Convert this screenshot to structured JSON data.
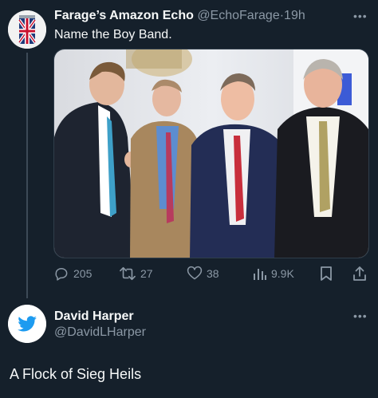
{
  "tweet": {
    "display_name": "Farage’s Amazon Echo",
    "handle": "@EchoFarage",
    "separator": "·",
    "time": "19h",
    "text": "Name the Boy Band.",
    "more_label": "•••",
    "stats": {
      "replies": "205",
      "retweets": "27",
      "likes": "38",
      "views": "9.9K"
    }
  },
  "reply": {
    "display_name": "David Harper",
    "handle": "@DavidLHarper",
    "more_label": "•••",
    "text": "A Flock of Sieg Heils"
  },
  "icons": {
    "reply": "comment-icon",
    "retweet": "retweet-icon",
    "like": "heart-icon",
    "views": "analytics-icon",
    "bookmark": "bookmark-icon",
    "share": "share-icon",
    "avatar1": "union-jack-can-avatar",
    "avatar2": "twitter-bird-avatar"
  },
  "colors": {
    "background": "#15202b",
    "text": "#f7f9f9",
    "secondary": "#8b98a5",
    "twitter_blue": "#1d9bf0"
  }
}
